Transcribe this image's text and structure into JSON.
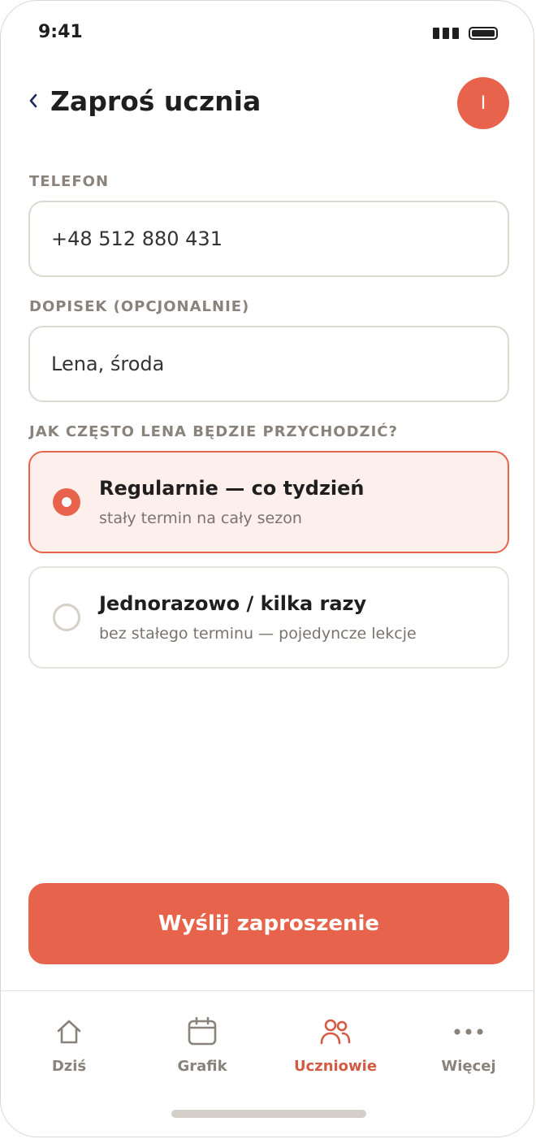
{
  "status_bar": {
    "time": "9:41"
  },
  "header": {
    "back_icon": "chevron-left-icon",
    "title": "Zaproś ucznia",
    "avatar_initial": "I"
  },
  "colors": {
    "accent": "#e8634b",
    "selected_background": "#fdf0ec",
    "label": "#8a837b",
    "text": "#1f1f1f"
  },
  "form": {
    "phone_label": "TELEFON",
    "phone_value": "+48 512 880 431",
    "note_label": "DOPISEK (OPCJONALNIE)",
    "note_value": "Lena, środa",
    "frequency_label": "JAK CZĘSTO LENA BĘDZIE PRZYCHODZIĆ?",
    "options": [
      {
        "title": "Regularnie — co tydzień",
        "subtitle": "stały termin na cały sezon",
        "selected": true
      },
      {
        "title": "Jednorazowo / kilka razy",
        "subtitle": "bez stałego terminu — pojedyncze lekcje",
        "selected": false
      }
    ],
    "submit_label": "Wyślij zaproszenie"
  },
  "tabbar": {
    "items": [
      {
        "label": "Dziś",
        "icon": "home-icon",
        "active": false
      },
      {
        "label": "Grafik",
        "icon": "calendar-icon",
        "active": false
      },
      {
        "label": "Uczniowie",
        "icon": "users-icon",
        "active": true
      },
      {
        "label": "Więcej",
        "icon": "more-dots-icon",
        "active": false
      }
    ]
  }
}
